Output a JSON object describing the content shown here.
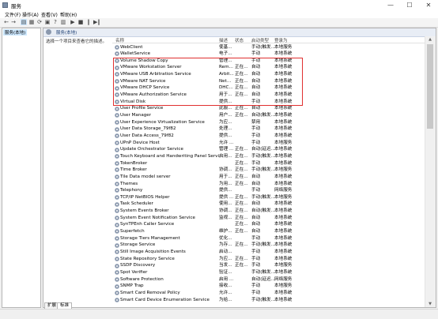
{
  "window": {
    "title": "服务",
    "min": "—",
    "max": "☐",
    "close": "✕"
  },
  "menu": [
    "文件(F)",
    "操作(A)",
    "查看(V)",
    "帮助(H)"
  ],
  "tree": {
    "item": "服务(本地)"
  },
  "pane": {
    "header": "服务(本地)",
    "hint": "选择一个项目来查看它的描述。"
  },
  "columns": {
    "name": "名称",
    "desc": "描述",
    "status": "状态",
    "startup": "启动类型",
    "logon": "登录为"
  },
  "rows": [
    {
      "name": "WebClient",
      "desc": "使基...",
      "status": "",
      "startup": "手动(触发...",
      "logon": "本地服务"
    },
    {
      "name": "WalletService",
      "desc": "电子...",
      "status": "",
      "startup": "手动",
      "logon": "本地系统"
    },
    {
      "name": "Volume Shadow Copy",
      "desc": "管理...",
      "status": "",
      "startup": "手动",
      "logon": "本地系统"
    },
    {
      "name": "VMware Workstation Server",
      "desc": "Rem...",
      "status": "正在...",
      "startup": "自动",
      "logon": "本地系统"
    },
    {
      "name": "VMware USB Arbitration Service",
      "desc": "Arbit...",
      "status": "正在...",
      "startup": "自动",
      "logon": "本地系统"
    },
    {
      "name": "VMware NAT Service",
      "desc": "Net...",
      "status": "正在...",
      "startup": "自动",
      "logon": "本地系统"
    },
    {
      "name": "VMware DHCP Service",
      "desc": "DHC...",
      "status": "正在...",
      "startup": "自动",
      "logon": "本地系统"
    },
    {
      "name": "VMware Authorization Service",
      "desc": "用于...",
      "status": "正在...",
      "startup": "自动",
      "logon": "本地系统"
    },
    {
      "name": "Virtual Disk",
      "desc": "提供...",
      "status": "",
      "startup": "手动",
      "logon": "本地系统"
    },
    {
      "name": "User Profile Service",
      "desc": "此服...",
      "status": "正在...",
      "startup": "自动",
      "logon": "本地系统"
    },
    {
      "name": "User Manager",
      "desc": "用户...",
      "status": "正在...",
      "startup": "自动(触发...",
      "logon": "本地系统"
    },
    {
      "name": "User Experience Virtualization Service",
      "desc": "为应...",
      "status": "",
      "startup": "禁用",
      "logon": "本地系统"
    },
    {
      "name": "User Data Storage_79f82",
      "desc": "处理...",
      "status": "",
      "startup": "手动",
      "logon": "本地系统"
    },
    {
      "name": "User Data Access_79f82",
      "desc": "提供...",
      "status": "",
      "startup": "手动",
      "logon": "本地系统"
    },
    {
      "name": "UPnP Device Host",
      "desc": "允许 ...",
      "status": "",
      "startup": "手动",
      "logon": "本地服务"
    },
    {
      "name": "Update Orchestrator Service",
      "desc": "管理 ...",
      "status": "正在...",
      "startup": "自动(延迟...",
      "logon": "本地系统"
    },
    {
      "name": "Touch Keyboard and Handwriting Panel Service",
      "desc": "启用...",
      "status": "正在...",
      "startup": "手动(触发...",
      "logon": "本地系统"
    },
    {
      "name": "TokenBroker",
      "desc": "",
      "status": "正在...",
      "startup": "手动",
      "logon": "本地系统"
    },
    {
      "name": "Time Broker",
      "desc": "协调...",
      "status": "正在...",
      "startup": "手动(触发...",
      "logon": "本地服务"
    },
    {
      "name": "Tile Data model server",
      "desc": "用于...",
      "status": "正在...",
      "startup": "自动",
      "logon": "本地系统"
    },
    {
      "name": "Themes",
      "desc": "为用...",
      "status": "正在...",
      "startup": "自动",
      "logon": "本地系统"
    },
    {
      "name": "Telephony",
      "desc": "提供...",
      "status": "",
      "startup": "手动",
      "logon": "网络服务"
    },
    {
      "name": "TCP/IP NetBIOS Helper",
      "desc": "提供 ...",
      "status": "正在...",
      "startup": "手动(触发...",
      "logon": "本地服务"
    },
    {
      "name": "Task Scheduler",
      "desc": "使用...",
      "status": "正在...",
      "startup": "自动",
      "logon": "本地系统"
    },
    {
      "name": "System Events Broker",
      "desc": "协调...",
      "status": "正在...",
      "startup": "自动(触发...",
      "logon": "本地系统"
    },
    {
      "name": "System Event Notification Service",
      "desc": "监视...",
      "status": "正在...",
      "startup": "自动",
      "logon": "本地系统"
    },
    {
      "name": "SynTPEnh Caller Service",
      "desc": "",
      "status": "正在...",
      "startup": "自动",
      "logon": "本地系统"
    },
    {
      "name": "Superfetch",
      "desc": "维护...",
      "status": "正在...",
      "startup": "自动",
      "logon": "本地系统"
    },
    {
      "name": "Storage Tiers Management",
      "desc": "优化...",
      "status": "",
      "startup": "手动",
      "logon": "本地系统"
    },
    {
      "name": "Storage Service",
      "desc": "为存...",
      "status": "正在...",
      "startup": "手动(触发...",
      "logon": "本地系统"
    },
    {
      "name": "Still Image Acquisition Events",
      "desc": "启动...",
      "status": "",
      "startup": "手动",
      "logon": "本地系统"
    },
    {
      "name": "State Repository Service",
      "desc": "为应...",
      "status": "正在...",
      "startup": "手动",
      "logon": "本地系统"
    },
    {
      "name": "SSDP Discovery",
      "desc": "当发...",
      "status": "正在...",
      "startup": "手动",
      "logon": "本地服务"
    },
    {
      "name": "Spot Verifier",
      "desc": "验证...",
      "status": "",
      "startup": "手动(触发...",
      "logon": "本地系统"
    },
    {
      "name": "Software Protection",
      "desc": "启用 ...",
      "status": "",
      "startup": "自动(延迟...",
      "logon": "网络服务"
    },
    {
      "name": "SNMP Trap",
      "desc": "接收...",
      "status": "",
      "startup": "手动",
      "logon": "本地服务"
    },
    {
      "name": "Smart Card Removal Policy",
      "desc": "允许...",
      "status": "",
      "startup": "手动",
      "logon": "本地系统"
    },
    {
      "name": "Smart Card Device Enumeration Service",
      "desc": "为给...",
      "status": "",
      "startup": "手动(触发...",
      "logon": "本地系统"
    }
  ],
  "tabs": [
    "扩展",
    "标准"
  ]
}
